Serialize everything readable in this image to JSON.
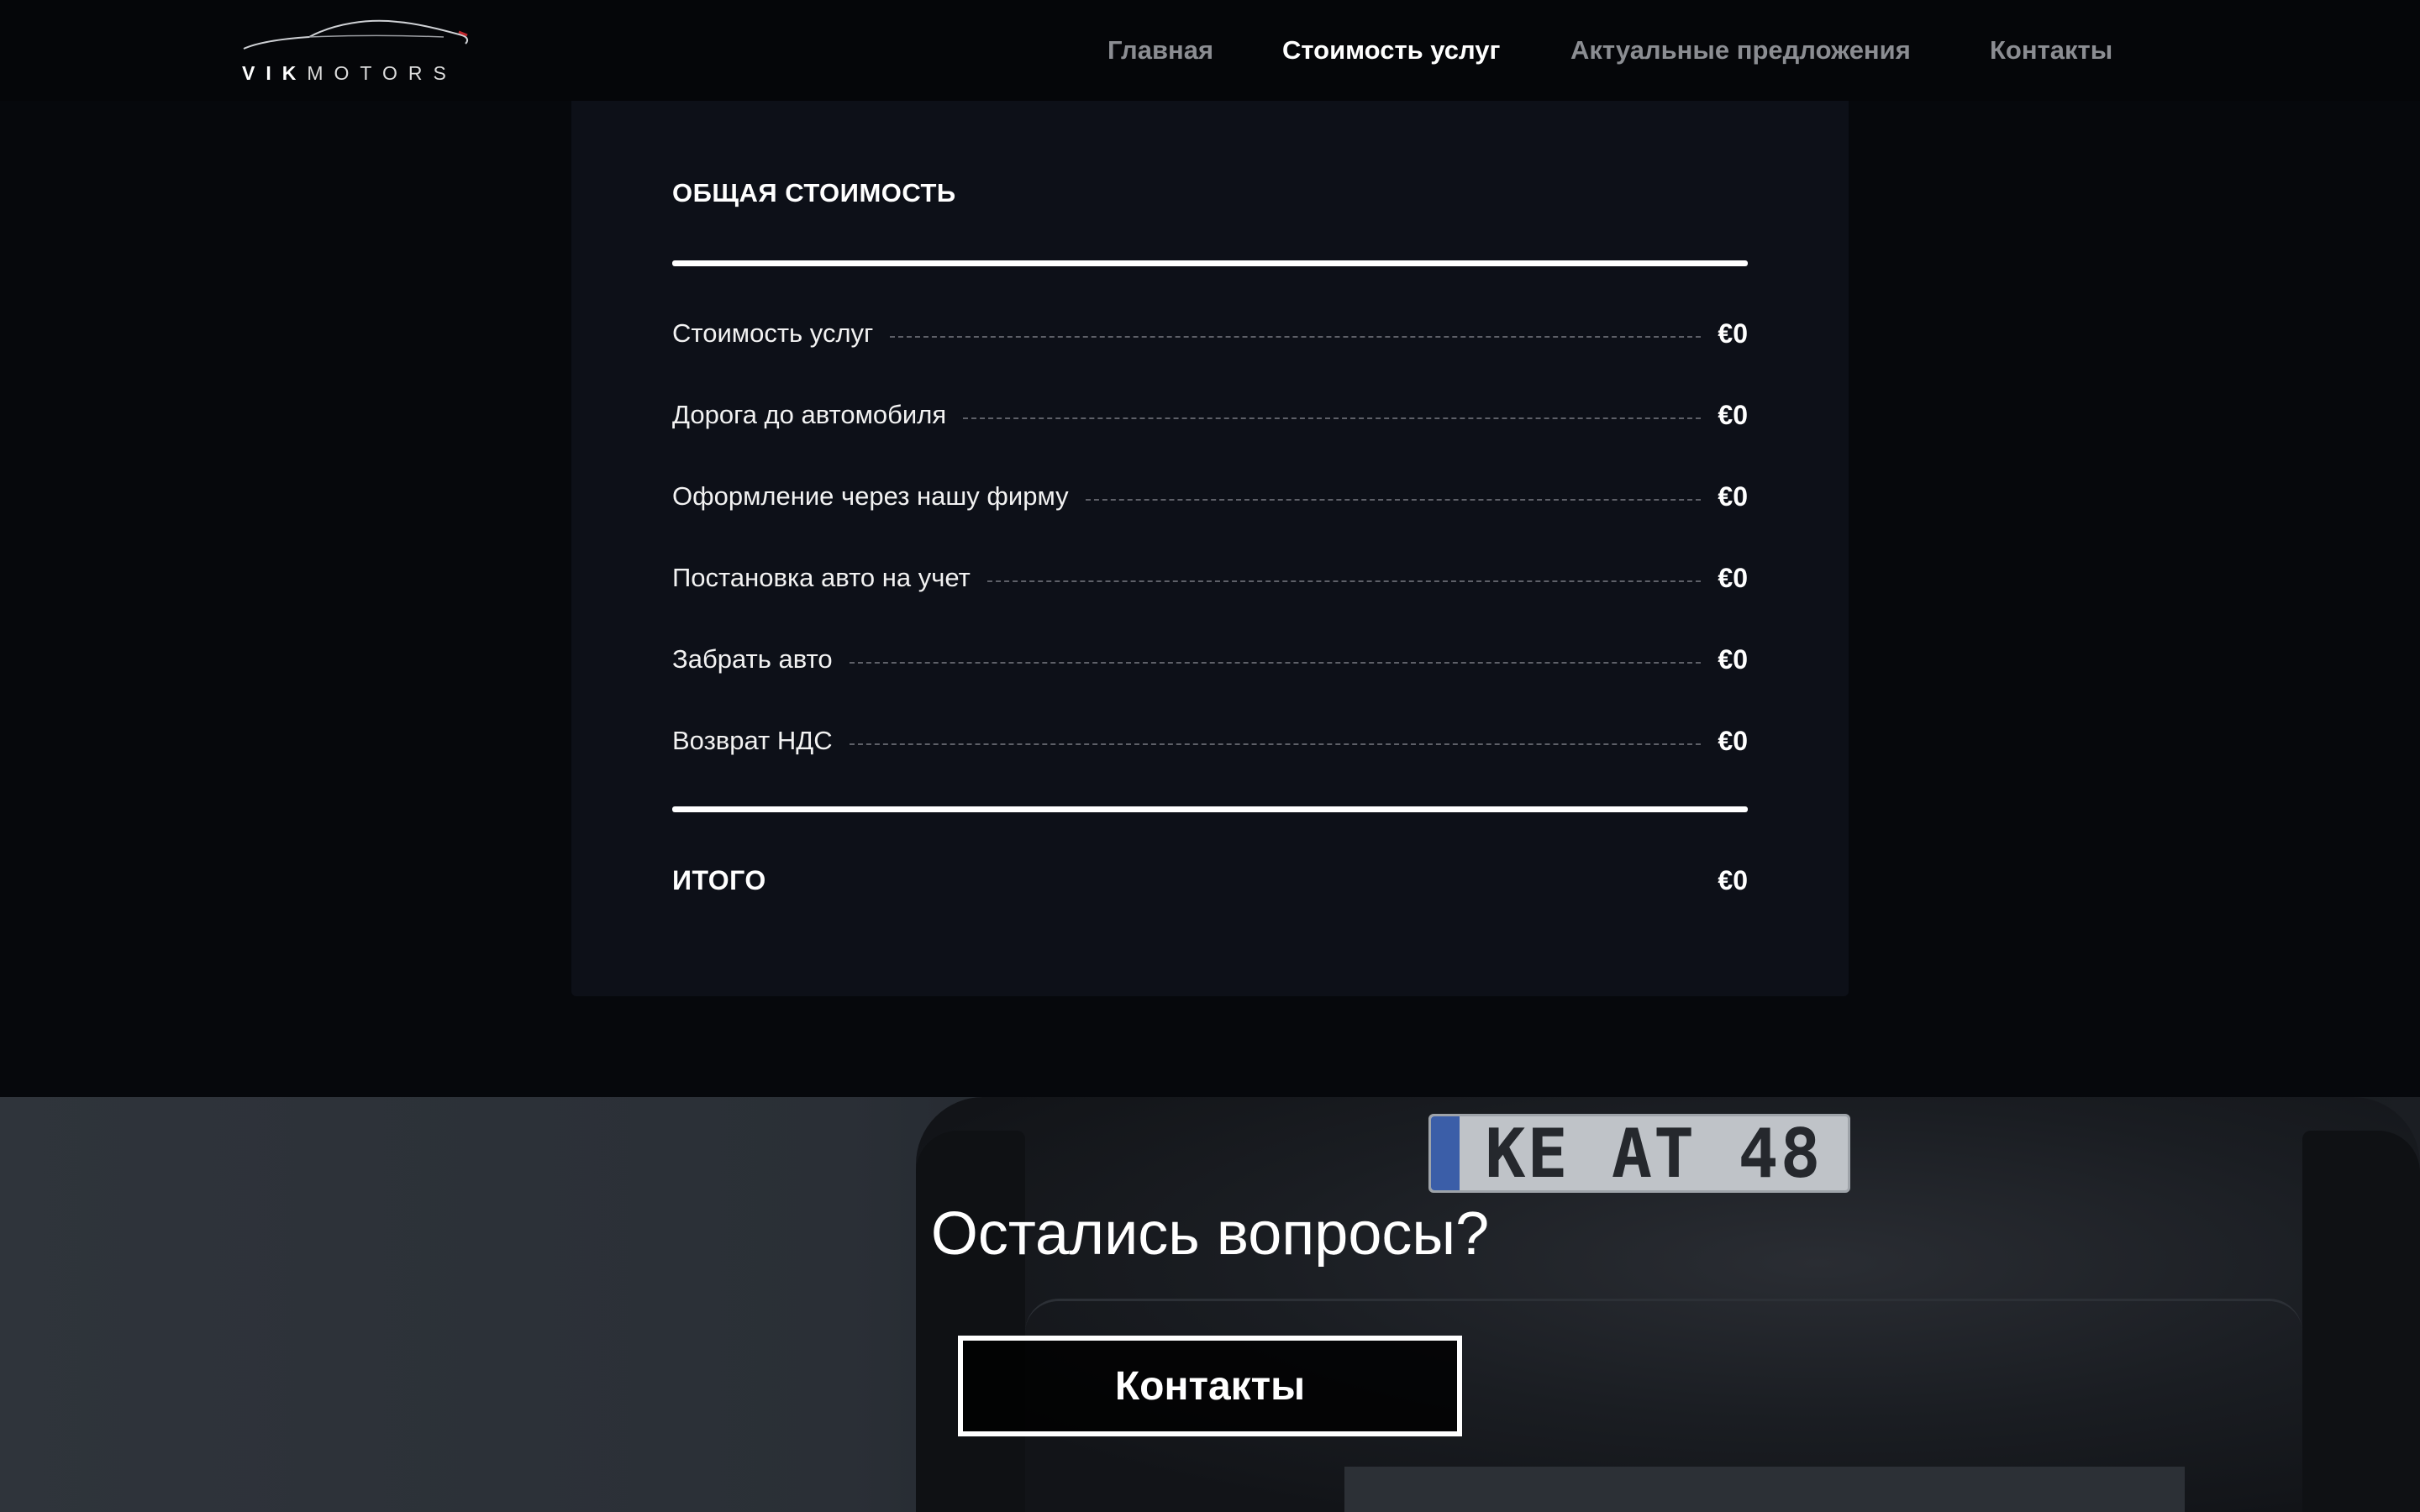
{
  "header": {
    "logo": {
      "part1": "VIK",
      "part2": "MOTORS"
    },
    "nav": [
      {
        "label": "Главная",
        "active": false
      },
      {
        "label": "Стоимость услуг",
        "active": true
      },
      {
        "label": "Актуальные предложения",
        "active": false
      },
      {
        "label": "Контакты",
        "active": false
      }
    ]
  },
  "summary": {
    "title": "ОБЩАЯ СТОИМОСТЬ",
    "items": [
      {
        "label": "Стоимость услуг",
        "amount": "€0"
      },
      {
        "label": "Дорога до автомобиля",
        "amount": "€0"
      },
      {
        "label": "Оформление через нашу фирму",
        "amount": "€0"
      },
      {
        "label": "Постановка авто на учет",
        "amount": "€0"
      },
      {
        "label": "Забрать авто",
        "amount": "€0"
      },
      {
        "label": "Возврат НДС",
        "amount": "€0"
      }
    ],
    "total_label": "ИТОГО",
    "total_amount": "€0"
  },
  "contact_section": {
    "question": "Остались вопросы?",
    "button_label": "Контакты",
    "plate_text": "KE AT 48"
  }
}
